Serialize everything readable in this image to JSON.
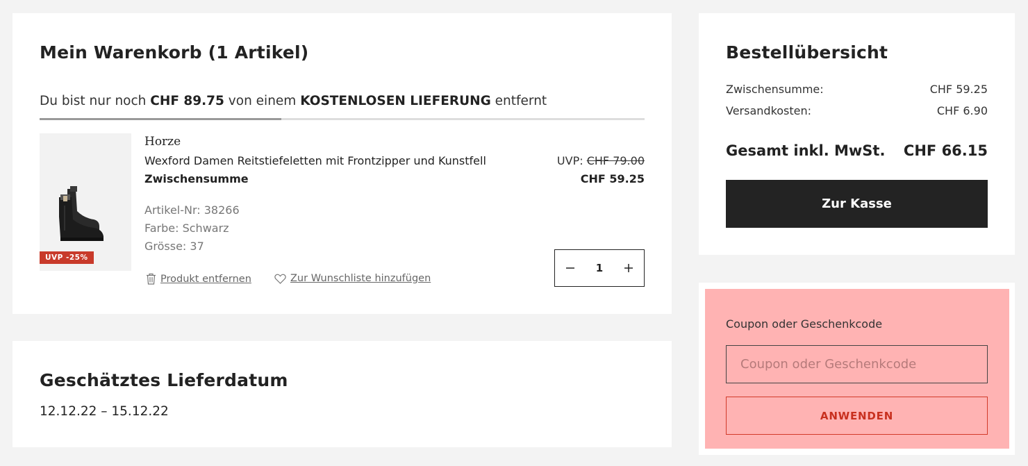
{
  "cart": {
    "title": "Mein Warenkorb (1 Artikel)",
    "shipping_message": {
      "prefix": "Du bist nur noch ",
      "amount": "CHF 89.75",
      "middle": " von einem ",
      "highlight": "KOSTENLOSEN LIEFERUNG",
      "suffix": " entfernt"
    },
    "free_shipping_progress": 0.4,
    "item": {
      "badge": "UVP -25%",
      "brand": "Horze",
      "name": "Wexford Damen Reitstiefeletten mit Frontzipper und Kunstfell",
      "subtotal_label": "Zwischensumme",
      "uvp_label": "UVP: ",
      "uvp_price": "CHF 79.00",
      "price": "CHF 59.25",
      "article_nr": "Artikel-Nr: 38266",
      "color": "Farbe: Schwarz",
      "size": "Grösse: 37",
      "quantity": "1",
      "remove_label": "Produkt entfernen",
      "wishlist_label": "Zur Wunschliste hinzufügen"
    }
  },
  "delivery": {
    "title": "Geschätztes Lieferdatum",
    "dates": "12.12.22 – 15.12.22"
  },
  "summary": {
    "title": "Bestellübersicht",
    "subtotal_label": "Zwischensumme:",
    "subtotal_value": "CHF 59.25",
    "shipping_label": "Versandkosten:",
    "shipping_value": "CHF 6.90",
    "total_label": "Gesamt inkl. MwSt.",
    "total_value": "CHF 66.15",
    "checkout_label": "Zur Kasse"
  },
  "coupon": {
    "label": "Coupon oder Geschenkcode",
    "placeholder": "Coupon oder Geschenkcode",
    "apply_label": "ANWENDEN"
  },
  "colors": {
    "badge": "#c83a2a",
    "checkout_bg": "#232323",
    "coupon_highlight": "#ffb3b3",
    "apply_accent": "#c8301f"
  }
}
